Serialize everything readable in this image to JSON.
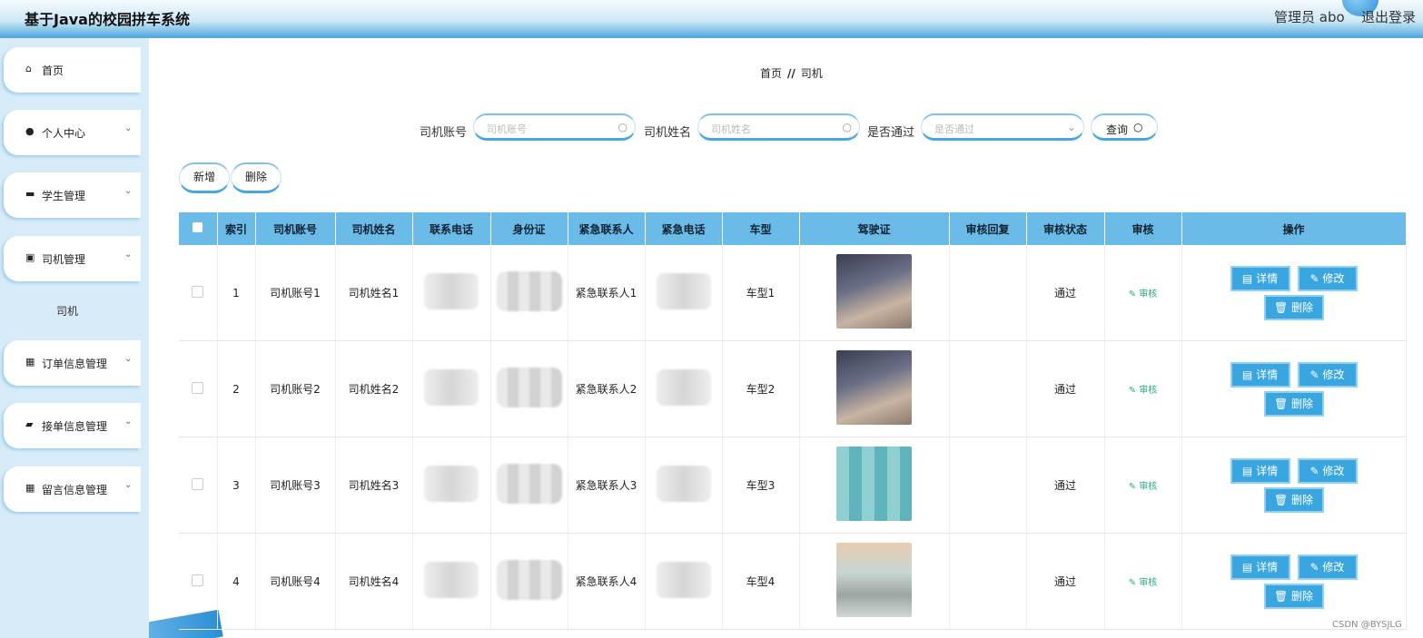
{
  "app_title": "基于Java的校园拼车系统",
  "header": {
    "admin_label": "管理员 abo",
    "logout": "退出登录"
  },
  "sidebar": {
    "items": [
      {
        "label": "首页",
        "icon": "home-icon"
      },
      {
        "label": "个人中心",
        "icon": "user-icon"
      },
      {
        "label": "学生管理",
        "icon": "message-icon"
      },
      {
        "label": "司机管理",
        "icon": "clipboard-icon"
      },
      {
        "label": "订单信息管理",
        "icon": "grid-icon"
      },
      {
        "label": "接单信息管理",
        "icon": "wallet-icon"
      },
      {
        "label": "留言信息管理",
        "icon": "grid-icon"
      }
    ],
    "submenu": "司机"
  },
  "breadcrumb": {
    "home": "首页",
    "sep": "//",
    "current": "司机"
  },
  "search": {
    "account_label": "司机账号",
    "account_placeholder": "司机账号",
    "name_label": "司机姓名",
    "name_placeholder": "司机姓名",
    "passed_label": "是否通过",
    "passed_placeholder": "是否通过",
    "query_button": "查询"
  },
  "actions": {
    "add": "新增",
    "delete": "删除"
  },
  "table": {
    "columns": [
      "索引",
      "司机账号",
      "司机姓名",
      "联系电话",
      "身份证",
      "紧急联系人",
      "紧急电话",
      "车型",
      "驾驶证",
      "审核回复",
      "审核状态",
      "审核",
      "操作"
    ],
    "rows": [
      {
        "index": "1",
        "account": "司机账号1",
        "name": "司机姓名1",
        "contact": "紧急联系人1",
        "car": "车型1",
        "status": "通过"
      },
      {
        "index": "2",
        "account": "司机账号2",
        "name": "司机姓名2",
        "contact": "紧急联系人2",
        "car": "车型2",
        "status": "通过"
      },
      {
        "index": "3",
        "account": "司机账号3",
        "name": "司机姓名3",
        "contact": "紧急联系人3",
        "car": "车型3",
        "status": "通过"
      },
      {
        "index": "4",
        "account": "司机账号4",
        "name": "司机姓名4",
        "contact": "紧急联系人4",
        "car": "车型4",
        "status": "通过"
      }
    ],
    "audit_label": "审核",
    "detail_label": "详情",
    "edit_label": "修改",
    "delete_label": "删除"
  },
  "watermark": "CSDN @BYSJLG"
}
